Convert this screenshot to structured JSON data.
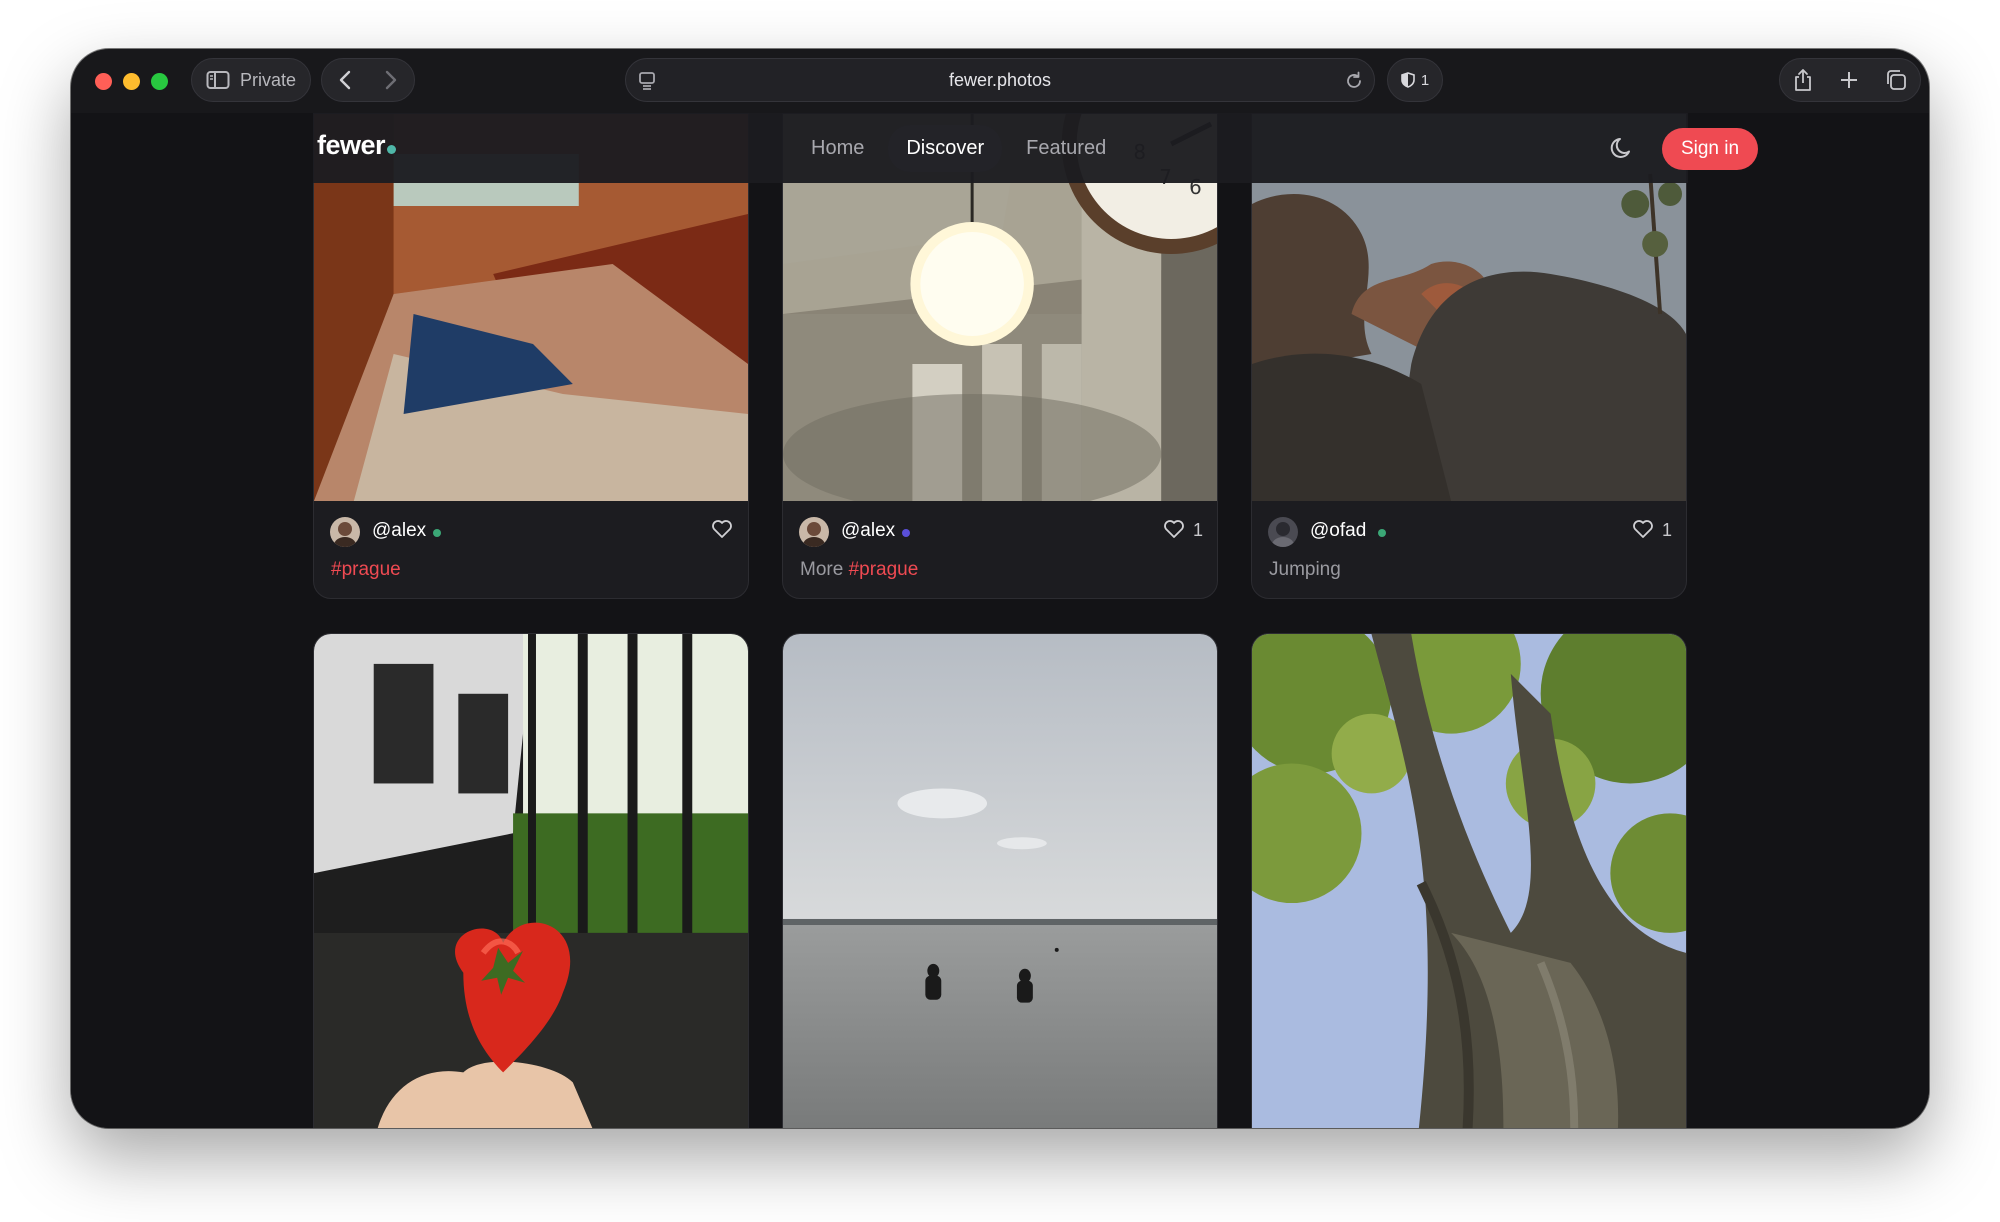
{
  "browser": {
    "private_label": "Private",
    "url": "fewer.photos",
    "shield_count": "1"
  },
  "site": {
    "logo": "fewer",
    "nav": [
      "Home",
      "Discover",
      "Featured"
    ],
    "active_nav": "Discover",
    "signin_label": "Sign in"
  },
  "posts": [
    {
      "user": "@alex",
      "status_color": "#3ba776",
      "likes": "",
      "caption_text": "",
      "caption_tag": "#prague"
    },
    {
      "user": "@alex",
      "status_color": "#5a4fd9",
      "likes": "1",
      "caption_text": "More ",
      "caption_tag": "#prague"
    },
    {
      "user": "@ofad",
      "status_color": "#3ba776",
      "likes": "1",
      "caption_text": "Jumping",
      "caption_tag": ""
    }
  ],
  "colors": {
    "accent": "#ef4a52",
    "window_bg": "#18181b",
    "page_bg": "#131316"
  }
}
